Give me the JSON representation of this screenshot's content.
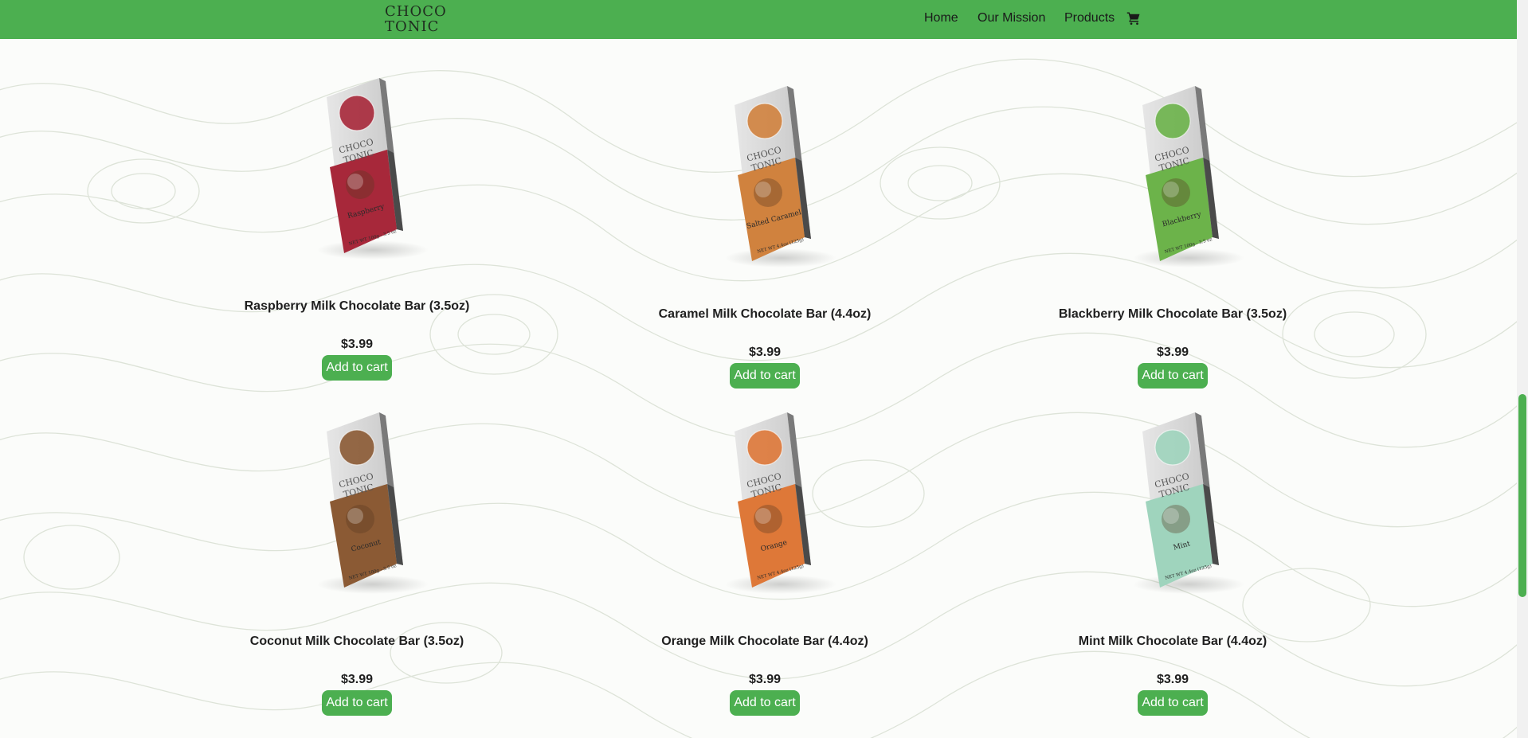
{
  "brand": {
    "logo_line1": "CHOCO",
    "logo_line2": "TONIC",
    "accent_color": "#4caf50"
  },
  "nav": {
    "home": "Home",
    "mission": "Our Mission",
    "products": "Products",
    "cart_icon": "cart-icon"
  },
  "products": [
    {
      "name": "Raspberry Milk Chocolate Bar (3.5oz)",
      "price": "$3.99",
      "button": "Add to cart",
      "pack_color": "#a7283a",
      "flavor_label": "Raspberry",
      "weight_label": "NET WT 100g - 3.5 oz"
    },
    {
      "name": "Caramel Milk Chocolate Bar (4.4oz)",
      "price": "$3.99",
      "button": "Add to cart",
      "pack_color": "#d0823e",
      "flavor_label": "Salted Caramel",
      "weight_label": "NET WT 4.4oz (125g)"
    },
    {
      "name": "Blackberry Milk Chocolate Bar (3.5oz)",
      "price": "$3.99",
      "button": "Add to cart",
      "pack_color": "#6cb34a",
      "flavor_label": "Blackberry",
      "weight_label": "NET WT 100g - 3.5 oz"
    },
    {
      "name": "Coconut Milk Chocolate Bar (3.5oz)",
      "price": "$3.99",
      "button": "Add to cart",
      "pack_color": "#8b5a34",
      "flavor_label": "Coconut",
      "weight_label": "NET WT 100g - 3.5 oz"
    },
    {
      "name": "Orange Milk Chocolate Bar (4.4oz)",
      "price": "$3.99",
      "button": "Add to cart",
      "pack_color": "#de7838",
      "flavor_label": "Orange",
      "weight_label": "NET WT 4.4oz (125g)"
    },
    {
      "name": "Mint Milk Chocolate Bar (4.4oz)",
      "price": "$3.99",
      "button": "Add to cart",
      "pack_color": "#9fd4bd",
      "flavor_label": "Mint",
      "weight_label": "NET WT 4.4oz (125g)"
    }
  ]
}
